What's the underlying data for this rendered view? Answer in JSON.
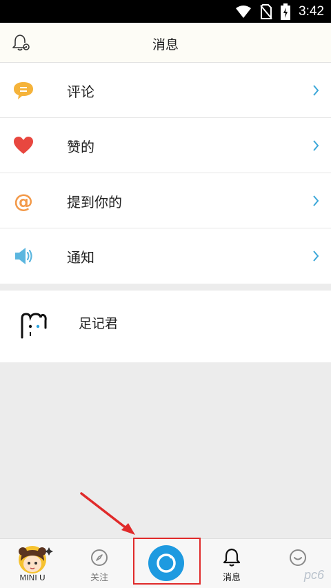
{
  "status_bar": {
    "time": "3:42"
  },
  "header": {
    "title": "消息",
    "left_icon": "bell-settings-icon"
  },
  "menu": [
    {
      "label": "评论",
      "icon": "comment-bubble-icon",
      "icon_color": "#f5b33a"
    },
    {
      "label": "赞的",
      "icon": "heart-icon",
      "icon_color": "#e8473f"
    },
    {
      "label": "提到你的",
      "icon": "at-sign-icon",
      "icon_color": "#f39a4a"
    },
    {
      "label": "通知",
      "icon": "speaker-icon",
      "icon_color": "#5bb6df"
    }
  ],
  "contact": {
    "name": "足记君"
  },
  "tabbar": {
    "tabs": [
      {
        "label": "MINI U",
        "icon": "avatar-icon"
      },
      {
        "label": "关注",
        "icon": "compass-icon"
      },
      {
        "label": "",
        "icon": "camera-icon"
      },
      {
        "label": "消息",
        "icon": "bell-icon",
        "active": true
      },
      {
        "label": "",
        "icon": "smile-icon"
      }
    ]
  },
  "watermark": "pc6"
}
